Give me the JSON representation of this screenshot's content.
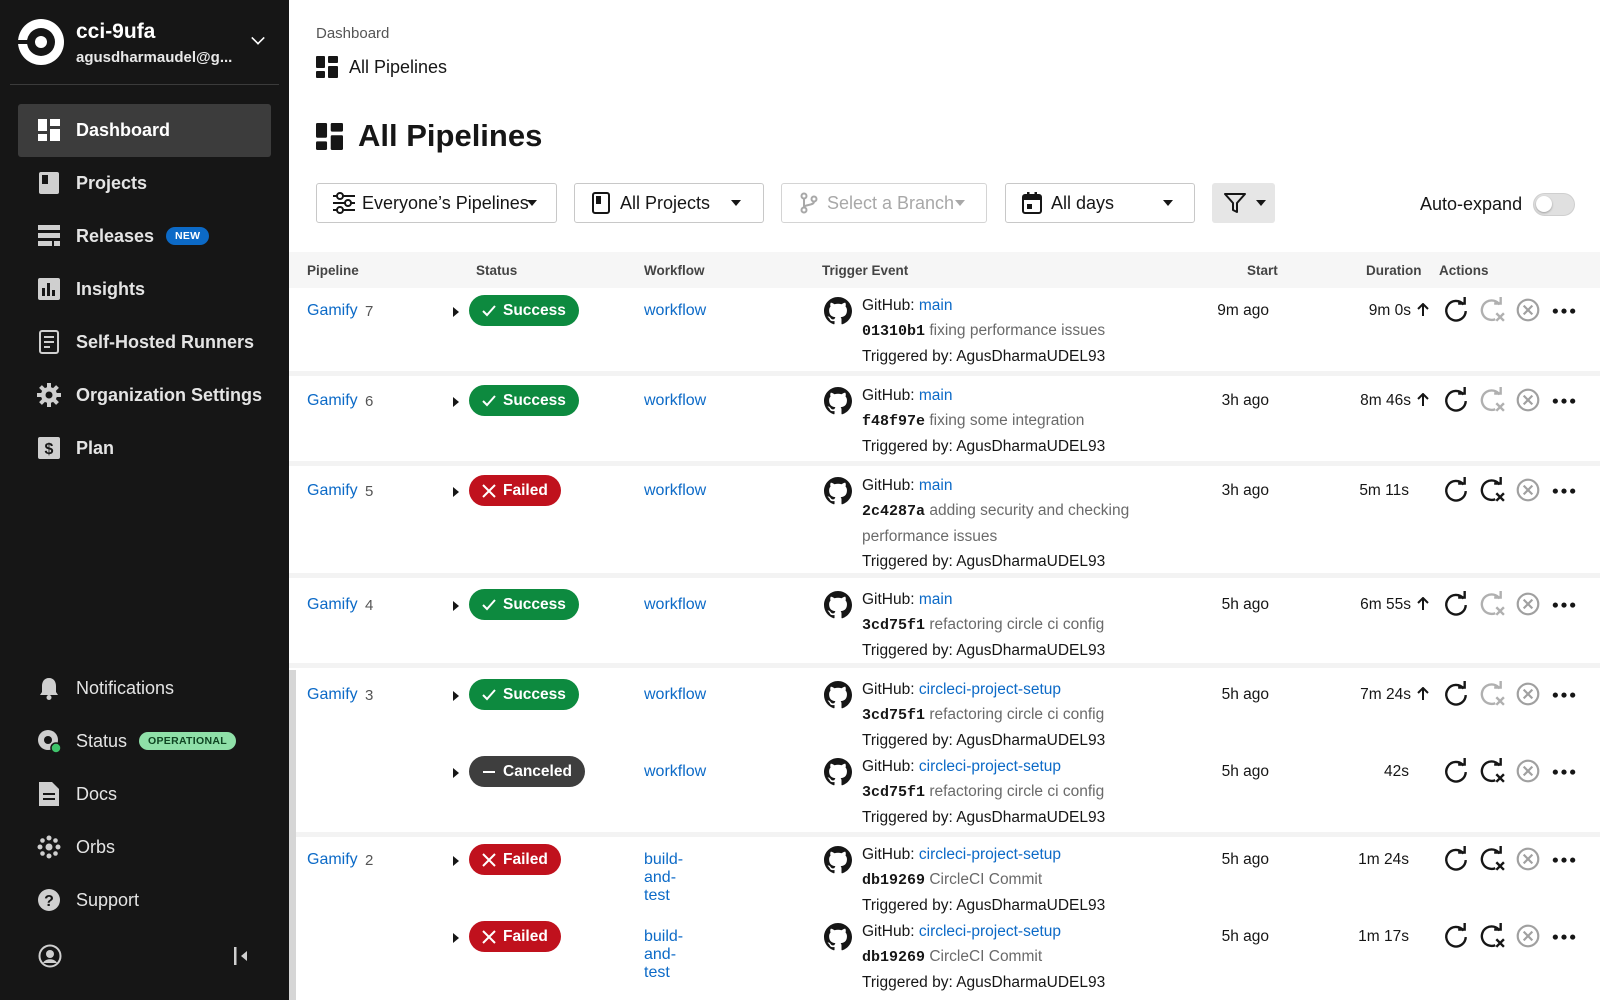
{
  "org": {
    "name": "cci-9ufa",
    "email": "agusdharmaudel@g..."
  },
  "nav": {
    "dashboard": "Dashboard",
    "projects": "Projects",
    "releases": "Releases",
    "releases_badge": "NEW",
    "insights": "Insights",
    "runners": "Self-Hosted Runners",
    "org_settings": "Organization Settings",
    "plan": "Plan",
    "notifications": "Notifications",
    "status": "Status",
    "status_badge": "OPERATIONAL",
    "docs": "Docs",
    "orbs": "Orbs",
    "support": "Support"
  },
  "breadcrumb": "Dashboard",
  "subtitle": "All Pipelines",
  "title": "All Pipelines",
  "filters": {
    "pipelines": "Everyone’s Pipelines",
    "projects": "All Projects",
    "branch": "Select a Branch",
    "days": "All days",
    "auto_expand": "Auto-expand"
  },
  "columns": {
    "pipeline": "Pipeline",
    "status": "Status",
    "workflow": "Workflow",
    "trigger": "Trigger Event",
    "start": "Start",
    "duration": "Duration",
    "actions": "Actions"
  },
  "rows": [
    {
      "name": "Gamify",
      "num": "7",
      "status": "Success",
      "workflow": "workflow",
      "source": "GitHub:",
      "branch": "main",
      "sha": "01310b1",
      "message": "fixing performance issues",
      "triggered": "Triggered by: AgusDharmaUDEL93",
      "start": "9m ago",
      "duration": "9m 0s"
    },
    {
      "name": "Gamify",
      "num": "6",
      "status": "Success",
      "workflow": "workflow",
      "source": "GitHub:",
      "branch": "main",
      "sha": "f48f97e",
      "message": "fixing some integration",
      "triggered": "Triggered by: AgusDharmaUDEL93",
      "start": "3h ago",
      "duration": "8m 46s"
    },
    {
      "name": "Gamify",
      "num": "5",
      "status": "Failed",
      "workflow": "workflow",
      "source": "GitHub:",
      "branch": "main",
      "sha": "2c4287a",
      "message": "adding security and checking performance issues",
      "triggered": "Triggered by: AgusDharmaUDEL93",
      "start": "3h ago",
      "duration": "5m 11s"
    },
    {
      "name": "Gamify",
      "num": "4",
      "status": "Success",
      "workflow": "workflow",
      "source": "GitHub:",
      "branch": "main",
      "sha": "3cd75f1",
      "message": "refactoring circle ci config",
      "triggered": "Triggered by: AgusDharmaUDEL93",
      "start": "5h ago",
      "duration": "6m 55s"
    },
    {
      "name": "Gamify",
      "num": "3",
      "status": "Success",
      "workflow": "workflow",
      "source": "GitHub:",
      "branch": "circleci-project-setup",
      "sha": "3cd75f1",
      "message": "refactoring circle ci config",
      "triggered": "Triggered by: AgusDharmaUDEL93",
      "start": "5h ago",
      "duration": "7m 24s"
    },
    {
      "name": "",
      "num": "",
      "status": "Canceled",
      "workflow": "workflow",
      "source": "GitHub:",
      "branch": "circleci-project-setup",
      "sha": "3cd75f1",
      "message": "refactoring circle ci config",
      "triggered": "Triggered by: AgusDharmaUDEL93",
      "start": "5h ago",
      "duration": "42s"
    },
    {
      "name": "Gamify",
      "num": "2",
      "status": "Failed",
      "workflow": "build-and-test",
      "source": "GitHub:",
      "branch": "circleci-project-setup",
      "sha": "db19269",
      "message": "CircleCI Commit",
      "triggered": "Triggered by: AgusDharmaUDEL93",
      "start": "5h ago",
      "duration": "1m 24s"
    },
    {
      "name": "",
      "num": "",
      "status": "Failed",
      "workflow": "build-and-test",
      "source": "GitHub:",
      "branch": "circleci-project-setup",
      "sha": "db19269",
      "message": "CircleCI Commit",
      "triggered": "Triggered by: AgusDharmaUDEL93",
      "start": "5h ago",
      "duration": "1m 17s"
    }
  ],
  "colors": {
    "success": "#0d8a3f",
    "failed": "#c0111d",
    "canceled": "#3e3e3e",
    "link": "#0c6ac7",
    "sidebar": "#161616"
  },
  "icons": [
    "dashboard-icon",
    "projects-icon",
    "releases-icon",
    "insights-icon",
    "runners-icon",
    "gear-icon",
    "dollar-icon",
    "bell-icon",
    "status-icon",
    "docs-icon",
    "orbs-icon",
    "help-icon",
    "user-icon",
    "github-icon",
    "rerun-icon",
    "rerun-failed-icon",
    "cancel-icon",
    "more-icon",
    "funnel-icon",
    "calendar-icon"
  ]
}
